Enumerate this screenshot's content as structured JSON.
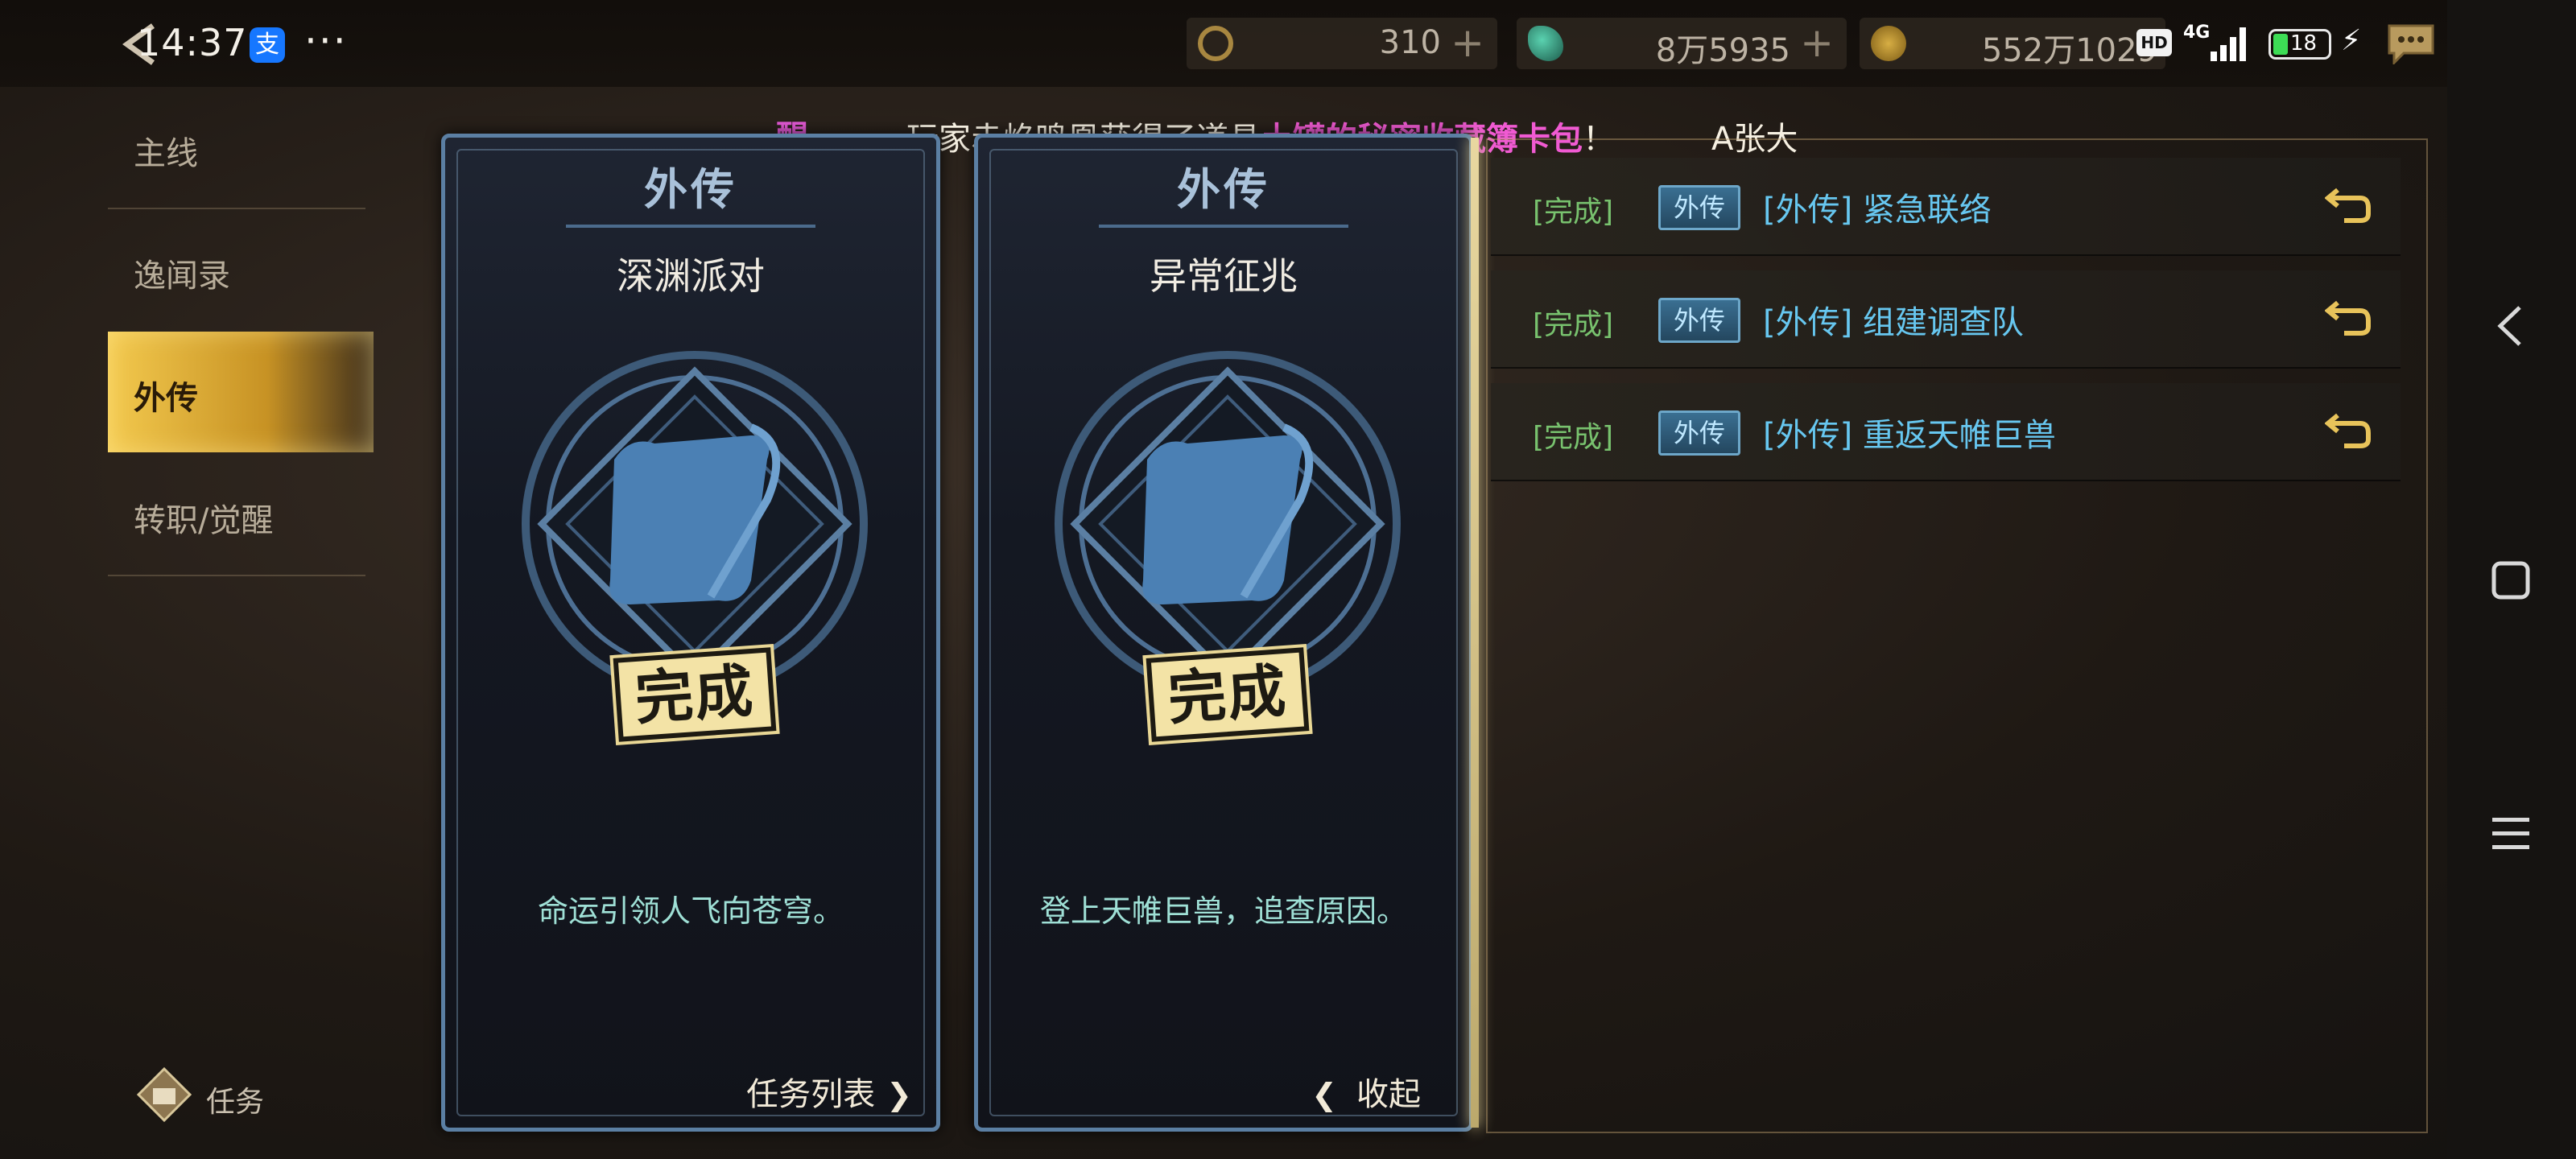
{
  "status_bar": {
    "time": "14:37",
    "alipay_label": "支",
    "more_label": "···",
    "network": "4G",
    "hd_label": "HD",
    "battery": "18"
  },
  "resources": [
    {
      "icon": "clock-coin-icon",
      "value": "310",
      "plus": "+"
    },
    {
      "icon": "gem-icon",
      "value": "8万5935",
      "plus": "+"
    },
    {
      "icon": "gold-coin-icon",
      "value": "552万1029",
      "plus": ""
    }
  ],
  "ticker": {
    "left_fragment": "醒",
    "prefix": "玩家赤焰鸣凰获得了道具",
    "item": "土罐的秘密收藏簿卡包",
    "suffix": "！",
    "next_name": "A张大"
  },
  "sidebar": {
    "items": [
      {
        "label": "主线"
      },
      {
        "label": "逸闻录"
      },
      {
        "label": "外传"
      },
      {
        "label": "转职/觉醒"
      }
    ],
    "active_index": 2,
    "footer_label": "任务"
  },
  "cards": [
    {
      "header": "外传",
      "title": "深渊派对",
      "stamp": "完成",
      "description": "命运引领人飞向苍穹。",
      "button": "任务列表"
    },
    {
      "header": "外传",
      "title": "异常征兆",
      "stamp": "完成",
      "description": "登上天帷巨兽，追查原因。",
      "button": "收起"
    }
  ],
  "quest_list": [
    {
      "status": "[完成]",
      "badge": "外传",
      "title": "[外传] 紧急联络"
    },
    {
      "status": "[完成]",
      "badge": "外传",
      "title": "[外传] 组建调查队"
    },
    {
      "status": "[完成]",
      "badge": "外传",
      "title": "[外传] 重返天帷巨兽"
    }
  ],
  "colors": {
    "accent_gold": "#f3c94e",
    "complete_green": "#78c26e",
    "quest_title_blue": "#67c7f0",
    "ticker_magenta": "#f05ad2"
  }
}
